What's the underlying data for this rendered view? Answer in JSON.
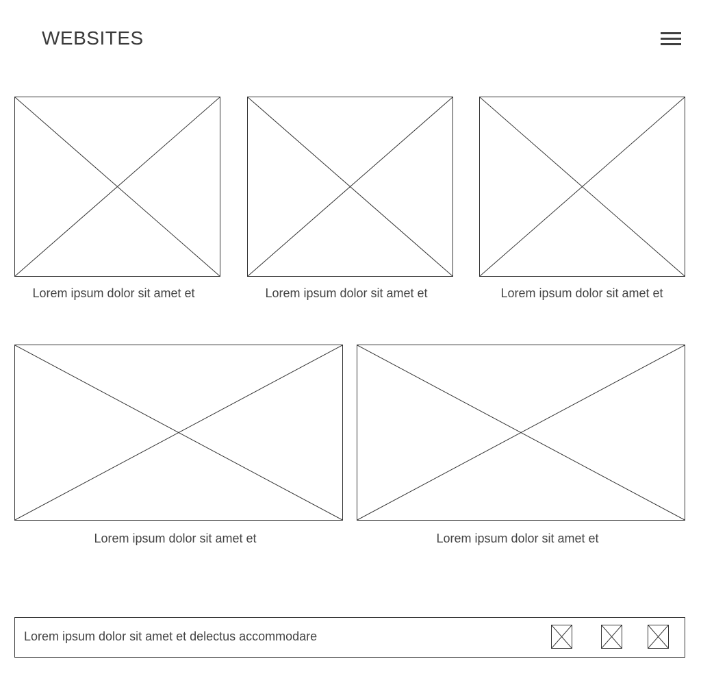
{
  "header": {
    "title": "WEBSITES",
    "menu_icon": "hamburger-menu-icon"
  },
  "gallery": {
    "row1": [
      {
        "caption": "Lorem ipsum dolor sit amet et",
        "image": "image-placeholder"
      },
      {
        "caption": "Lorem ipsum dolor sit amet et",
        "image": "image-placeholder"
      },
      {
        "caption": "Lorem ipsum dolor sit amet et",
        "image": "image-placeholder"
      }
    ],
    "row2": [
      {
        "caption": "Lorem ipsum dolor sit amet et",
        "image": "image-placeholder"
      },
      {
        "caption": "Lorem ipsum dolor sit amet et",
        "image": "image-placeholder"
      }
    ]
  },
  "footer": {
    "text": "Lorem ipsum dolor sit amet et delectus accommodare",
    "icons": [
      "social-icon-placeholder",
      "social-icon-placeholder",
      "social-icon-placeholder"
    ]
  },
  "colors": {
    "text": "#444444",
    "lines": "#333333",
    "background": "#ffffff"
  }
}
